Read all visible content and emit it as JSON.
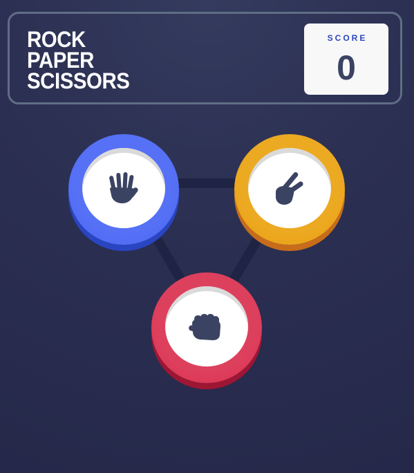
{
  "header": {
    "title_lines": [
      "ROCK",
      "PAPER",
      "SCISSORS"
    ],
    "score_label": "SCORE",
    "score_value": "0"
  },
  "choices": [
    {
      "id": "paper",
      "icon": "paper-hand-icon",
      "ring_color": "#4865f4",
      "shadow_color": "#2a45c2"
    },
    {
      "id": "scissors",
      "icon": "scissors-hand-icon",
      "ring_color": "#ec9e0e",
      "shadow_color": "#c76c1b"
    },
    {
      "id": "rock",
      "icon": "rock-fist-icon",
      "ring_color": "#dc2e4e",
      "shadow_color": "#9d1634"
    }
  ],
  "colors": {
    "background": "#2b2f52",
    "header_outline": "#606e85",
    "icon_fill": "#3b4363",
    "score_label": "#2a46c0"
  }
}
